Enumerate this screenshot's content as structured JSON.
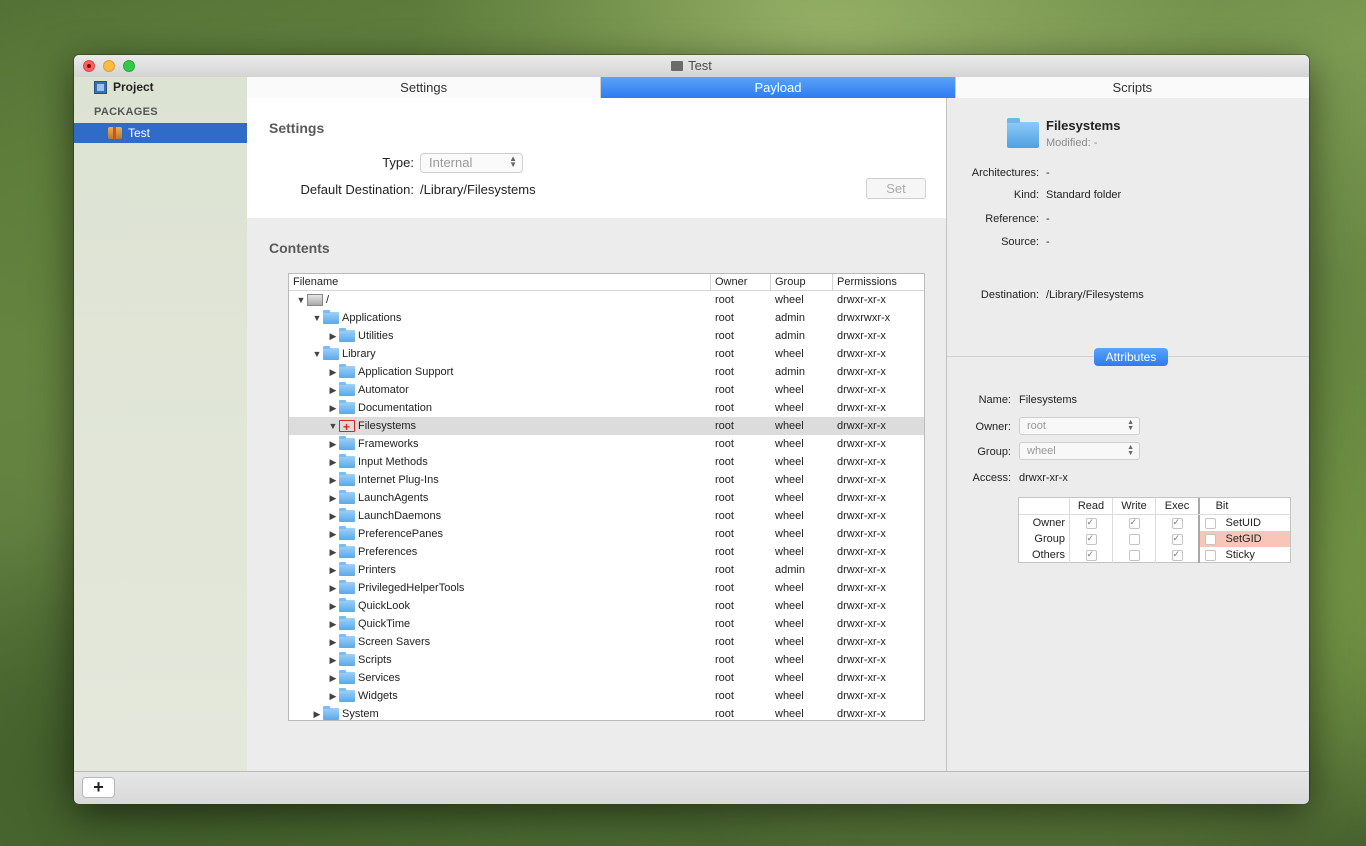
{
  "window": {
    "title": "Test"
  },
  "sidebar": {
    "project_label": "Project",
    "packages_header": "PACKAGES",
    "packages": [
      {
        "label": "Test"
      }
    ],
    "add_button": "+"
  },
  "tabs": [
    {
      "label": "Settings",
      "active": false
    },
    {
      "label": "Payload",
      "active": true
    },
    {
      "label": "Scripts",
      "active": false
    }
  ],
  "settings": {
    "title": "Settings",
    "type_label": "Type:",
    "type_value": "Internal",
    "dest_label": "Default Destination:",
    "dest_value": "/Library/Filesystems",
    "set_button": "Set"
  },
  "contents": {
    "title": "Contents",
    "columns": [
      "Filename",
      "Owner",
      "Group",
      "Permissions"
    ],
    "rows": [
      {
        "name": "/",
        "owner": "root",
        "group": "wheel",
        "perm": "drwxr-xr-x",
        "level": 0,
        "disc": "open",
        "icon": "disk-icon"
      },
      {
        "name": "Applications",
        "owner": "root",
        "group": "admin",
        "perm": "drwxrwxr-x",
        "level": 1,
        "disc": "open",
        "icon": "folder-icon"
      },
      {
        "name": "Utilities",
        "owner": "root",
        "group": "admin",
        "perm": "drwxr-xr-x",
        "level": 2,
        "disc": "closed",
        "icon": "folder-icon"
      },
      {
        "name": "Library",
        "owner": "root",
        "group": "wheel",
        "perm": "drwxr-xr-x",
        "level": 1,
        "disc": "open",
        "icon": "folder-icon"
      },
      {
        "name": "Application Support",
        "owner": "root",
        "group": "admin",
        "perm": "drwxr-xr-x",
        "level": 2,
        "disc": "closed",
        "icon": "folder-icon"
      },
      {
        "name": "Automator",
        "owner": "root",
        "group": "wheel",
        "perm": "drwxr-xr-x",
        "level": 2,
        "disc": "closed",
        "icon": "folder-icon"
      },
      {
        "name": "Documentation",
        "owner": "root",
        "group": "wheel",
        "perm": "drwxr-xr-x",
        "level": 2,
        "disc": "closed",
        "icon": "folder-icon"
      },
      {
        "name": "Filesystems",
        "owner": "root",
        "group": "wheel",
        "perm": "drwxr-xr-x",
        "level": 2,
        "disc": "open",
        "icon": "target-folder-icon",
        "selected": true
      },
      {
        "name": "Frameworks",
        "owner": "root",
        "group": "wheel",
        "perm": "drwxr-xr-x",
        "level": 2,
        "disc": "closed",
        "icon": "folder-icon"
      },
      {
        "name": "Input Methods",
        "owner": "root",
        "group": "wheel",
        "perm": "drwxr-xr-x",
        "level": 2,
        "disc": "closed",
        "icon": "folder-icon"
      },
      {
        "name": "Internet Plug-Ins",
        "owner": "root",
        "group": "wheel",
        "perm": "drwxr-xr-x",
        "level": 2,
        "disc": "closed",
        "icon": "folder-icon"
      },
      {
        "name": "LaunchAgents",
        "owner": "root",
        "group": "wheel",
        "perm": "drwxr-xr-x",
        "level": 2,
        "disc": "closed",
        "icon": "folder-icon"
      },
      {
        "name": "LaunchDaemons",
        "owner": "root",
        "group": "wheel",
        "perm": "drwxr-xr-x",
        "level": 2,
        "disc": "closed",
        "icon": "folder-icon"
      },
      {
        "name": "PreferencePanes",
        "owner": "root",
        "group": "wheel",
        "perm": "drwxr-xr-x",
        "level": 2,
        "disc": "closed",
        "icon": "folder-icon"
      },
      {
        "name": "Preferences",
        "owner": "root",
        "group": "wheel",
        "perm": "drwxr-xr-x",
        "level": 2,
        "disc": "closed",
        "icon": "folder-icon"
      },
      {
        "name": "Printers",
        "owner": "root",
        "group": "admin",
        "perm": "drwxr-xr-x",
        "level": 2,
        "disc": "closed",
        "icon": "folder-icon"
      },
      {
        "name": "PrivilegedHelperTools",
        "owner": "root",
        "group": "wheel",
        "perm": "drwxr-xr-x",
        "level": 2,
        "disc": "closed",
        "icon": "folder-icon"
      },
      {
        "name": "QuickLook",
        "owner": "root",
        "group": "wheel",
        "perm": "drwxr-xr-x",
        "level": 2,
        "disc": "closed",
        "icon": "folder-icon"
      },
      {
        "name": "QuickTime",
        "owner": "root",
        "group": "wheel",
        "perm": "drwxr-xr-x",
        "level": 2,
        "disc": "closed",
        "icon": "folder-icon"
      },
      {
        "name": "Screen Savers",
        "owner": "root",
        "group": "wheel",
        "perm": "drwxr-xr-x",
        "level": 2,
        "disc": "closed",
        "icon": "folder-icon"
      },
      {
        "name": "Scripts",
        "owner": "root",
        "group": "wheel",
        "perm": "drwxr-xr-x",
        "level": 2,
        "disc": "closed",
        "icon": "folder-icon"
      },
      {
        "name": "Services",
        "owner": "root",
        "group": "wheel",
        "perm": "drwxr-xr-x",
        "level": 2,
        "disc": "closed",
        "icon": "folder-icon"
      },
      {
        "name": "Widgets",
        "owner": "root",
        "group": "wheel",
        "perm": "drwxr-xr-x",
        "level": 2,
        "disc": "closed",
        "icon": "folder-icon"
      },
      {
        "name": "System",
        "owner": "root",
        "group": "wheel",
        "perm": "drwxr-xr-x",
        "level": 1,
        "disc": "closed",
        "icon": "folder-icon"
      }
    ],
    "add_label": "+",
    "remove_label": "−"
  },
  "info": {
    "name": "Filesystems",
    "modified": "Modified:  -",
    "architectures_label": "Architectures:",
    "architectures": "-",
    "kind_label": "Kind:",
    "kind": "Standard folder",
    "reference_label": "Reference:",
    "reference": "-",
    "source_label": "Source:",
    "source": "-",
    "destination_label": "Destination:",
    "destination": "/Library/Filesystems"
  },
  "attributes": {
    "button": "Attributes",
    "name_label": "Name:",
    "name": "Filesystems",
    "owner_label": "Owner:",
    "owner": "root",
    "group_label": "Group:",
    "group": "wheel",
    "access_label": "Access:",
    "access": "drwxr-xr-x",
    "perm_headers": {
      "read": "Read",
      "write": "Write",
      "exec": "Exec",
      "bit": "Bit"
    },
    "perm_rows": [
      {
        "label": "Owner",
        "read": true,
        "write": true,
        "exec": true,
        "bit": false,
        "bit_label": "SetUID"
      },
      {
        "label": "Group",
        "read": true,
        "write": false,
        "exec": true,
        "bit": false,
        "bit_label": "SetGID",
        "highlight": true
      },
      {
        "label": "Others",
        "read": true,
        "write": false,
        "exec": true,
        "bit": false,
        "bit_label": "Sticky"
      }
    ]
  }
}
